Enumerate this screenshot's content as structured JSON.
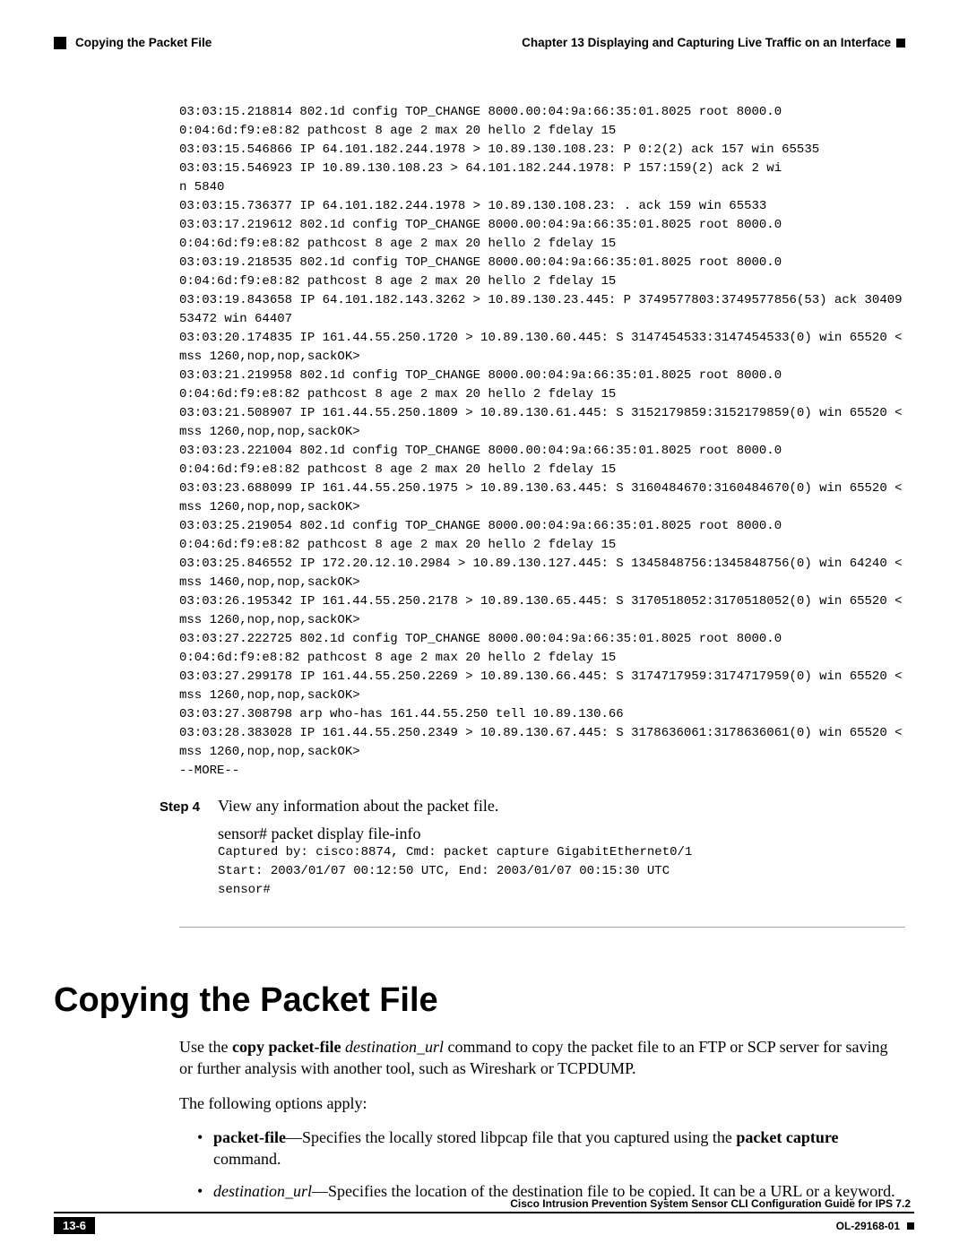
{
  "header": {
    "section": "Copying the Packet File",
    "chapter": "Chapter 13    Displaying and Capturing Live Traffic on an Interface"
  },
  "dump": "03:03:15.218814 802.1d config TOP_CHANGE 8000.00:04:9a:66:35:01.8025 root 8000.0\n0:04:6d:f9:e8:82 pathcost 8 age 2 max 20 hello 2 fdelay 15\n03:03:15.546866 IP 64.101.182.244.1978 > 10.89.130.108.23: P 0:2(2) ack 157 win 65535\n03:03:15.546923 IP 10.89.130.108.23 > 64.101.182.244.1978: P 157:159(2) ack 2 wi\nn 5840\n03:03:15.736377 IP 64.101.182.244.1978 > 10.89.130.108.23: . ack 159 win 65533\n03:03:17.219612 802.1d config TOP_CHANGE 8000.00:04:9a:66:35:01.8025 root 8000.0\n0:04:6d:f9:e8:82 pathcost 8 age 2 max 20 hello 2 fdelay 15\n03:03:19.218535 802.1d config TOP_CHANGE 8000.00:04:9a:66:35:01.8025 root 8000.0\n0:04:6d:f9:e8:82 pathcost 8 age 2 max 20 hello 2 fdelay 15\n03:03:19.843658 IP 64.101.182.143.3262 > 10.89.130.23.445: P 3749577803:3749577856(53) ack 3040953472 win 64407\n03:03:20.174835 IP 161.44.55.250.1720 > 10.89.130.60.445: S 3147454533:3147454533(0) win 65520 <mss 1260,nop,nop,sackOK>\n03:03:21.219958 802.1d config TOP_CHANGE 8000.00:04:9a:66:35:01.8025 root 8000.0\n0:04:6d:f9:e8:82 pathcost 8 age 2 max 20 hello 2 fdelay 15\n03:03:21.508907 IP 161.44.55.250.1809 > 10.89.130.61.445: S 3152179859:3152179859(0) win 65520 <mss 1260,nop,nop,sackOK>\n03:03:23.221004 802.1d config TOP_CHANGE 8000.00:04:9a:66:35:01.8025 root 8000.0\n0:04:6d:f9:e8:82 pathcost 8 age 2 max 20 hello 2 fdelay 15\n03:03:23.688099 IP 161.44.55.250.1975 > 10.89.130.63.445: S 3160484670:3160484670(0) win 65520 <mss 1260,nop,nop,sackOK>\n03:03:25.219054 802.1d config TOP_CHANGE 8000.00:04:9a:66:35:01.8025 root 8000.0\n0:04:6d:f9:e8:82 pathcost 8 age 2 max 20 hello 2 fdelay 15\n03:03:25.846552 IP 172.20.12.10.2984 > 10.89.130.127.445: S 1345848756:1345848756(0) win 64240 <mss 1460,nop,nop,sackOK>\n03:03:26.195342 IP 161.44.55.250.2178 > 10.89.130.65.445: S 3170518052:3170518052(0) win 65520 <mss 1260,nop,nop,sackOK>\n03:03:27.222725 802.1d config TOP_CHANGE 8000.00:04:9a:66:35:01.8025 root 8000.0\n0:04:6d:f9:e8:82 pathcost 8 age 2 max 20 hello 2 fdelay 15\n03:03:27.299178 IP 161.44.55.250.2269 > 10.89.130.66.445: S 3174717959:3174717959(0) win 65520 <mss 1260,nop,nop,sackOK>\n03:03:27.308798 arp who-has 161.44.55.250 tell 10.89.130.66\n03:03:28.383028 IP 161.44.55.250.2349 > 10.89.130.67.445: S 3178636061:3178636061(0) win 65520 <mss 1260,nop,nop,sackOK>\n--MORE--",
  "step4": {
    "label": "Step 4",
    "text": "View any information about the packet file.",
    "prompt": "sensor# ",
    "cmd": "packet display file-info",
    "output": "Captured by: cisco:8874, Cmd: packet capture GigabitEthernet0/1\nStart: 2003/01/07 00:12:50 UTC, End: 2003/01/07 00:15:30 UTC\nsensor#"
  },
  "section": {
    "title": "Copying the Packet File",
    "intro_prefix": "Use the ",
    "intro_cmd": "copy packet-file",
    "intro_arg": " destination_url",
    "intro_suffix": " command to copy the packet file to an FTP or SCP server for saving or further analysis with another tool, such as Wireshark or TCPDUMP.",
    "options_intro": "The following options apply:",
    "bullet1_b": "packet-file",
    "bullet1_mid": "—Specifies the locally stored libpcap file that you captured using the ",
    "bullet1_b2": "packet capture",
    "bullet1_end": " command.",
    "bullet2_i": "destination_url",
    "bullet2_rest": "—Specifies the location of the destination file to be copied. It can be a URL or a keyword."
  },
  "footer": {
    "guide": "Cisco Intrusion Prevention System Sensor CLI Configuration Guide for IPS 7.2",
    "page_num": "13-6",
    "doc_id": "OL-29168-01"
  }
}
